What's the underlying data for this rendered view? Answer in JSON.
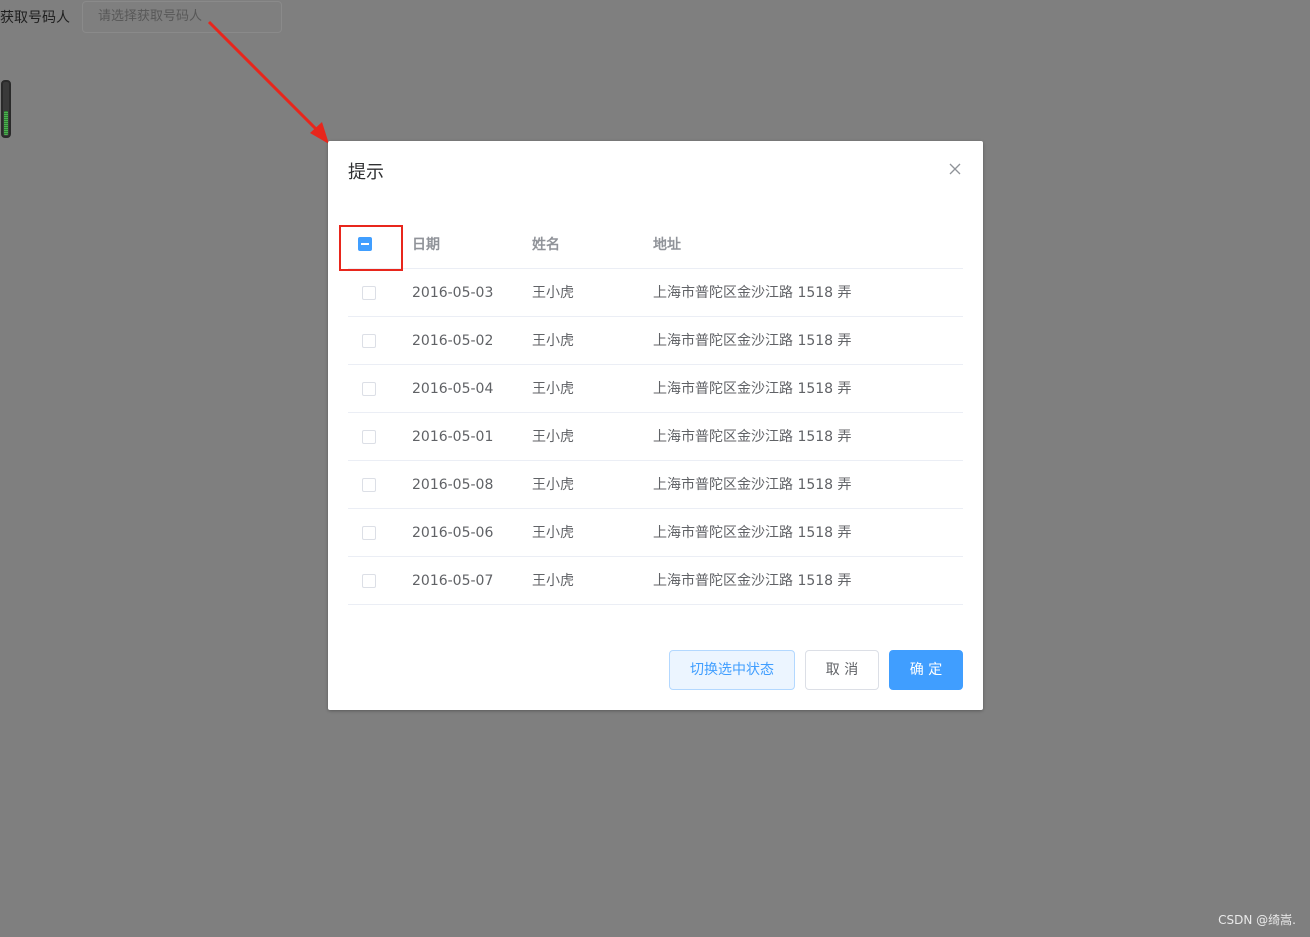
{
  "background": {
    "form_label": "获取号码人",
    "input_placeholder": "请选择获取号码人"
  },
  "dialog": {
    "title": "提示",
    "table": {
      "headers": {
        "date": "日期",
        "name": "姓名",
        "address": "地址"
      },
      "header_checkbox_state": "indeterminate",
      "rows": [
        {
          "date": "2016-05-03",
          "name": "王小虎",
          "address": "上海市普陀区金沙江路 1518 弄",
          "checked": false
        },
        {
          "date": "2016-05-02",
          "name": "王小虎",
          "address": "上海市普陀区金沙江路 1518 弄",
          "checked": false
        },
        {
          "date": "2016-05-04",
          "name": "王小虎",
          "address": "上海市普陀区金沙江路 1518 弄",
          "checked": false
        },
        {
          "date": "2016-05-01",
          "name": "王小虎",
          "address": "上海市普陀区金沙江路 1518 弄",
          "checked": false
        },
        {
          "date": "2016-05-08",
          "name": "王小虎",
          "address": "上海市普陀区金沙江路 1518 弄",
          "checked": false
        },
        {
          "date": "2016-05-06",
          "name": "王小虎",
          "address": "上海市普陀区金沙江路 1518 弄",
          "checked": false
        },
        {
          "date": "2016-05-07",
          "name": "王小虎",
          "address": "上海市普陀区金沙江路 1518 弄",
          "checked": false
        }
      ]
    },
    "buttons": {
      "toggle": "切换选中状态",
      "cancel": "取 消",
      "confirm": "确 定"
    }
  },
  "watermark": "CSDN @绮嵩.",
  "colors": {
    "overlay": "#7f7f7f",
    "primary": "#409eff",
    "annotation": "#e8261c"
  }
}
